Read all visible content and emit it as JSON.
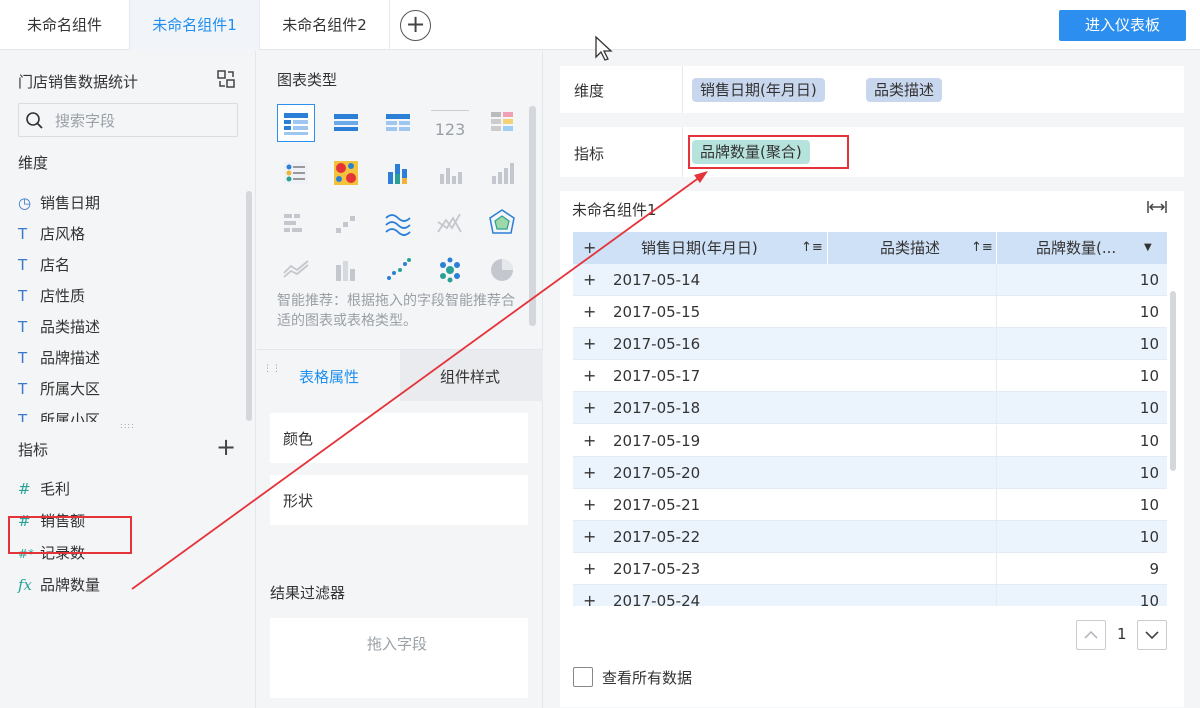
{
  "tabs": [
    {
      "label": "未命名组件"
    },
    {
      "label": "未命名组件1"
    },
    {
      "label": "未命名组件2"
    }
  ],
  "add_tab_symbol": "+",
  "enter_dashboard_label": "进入仪表板",
  "left": {
    "dataset_title": "门店销售数据统计",
    "search_placeholder": "搜索字段",
    "dimensions_label": "维度",
    "dimension_fields": [
      {
        "label": "销售日期",
        "icon": "clock-icon",
        "glyph": "◷"
      },
      {
        "label": "店风格",
        "icon": "text-type-icon",
        "glyph": "T"
      },
      {
        "label": "店名",
        "icon": "text-type-icon",
        "glyph": "T"
      },
      {
        "label": "店性质",
        "icon": "text-type-icon",
        "glyph": "T"
      },
      {
        "label": "品类描述",
        "icon": "text-type-icon",
        "glyph": "T"
      },
      {
        "label": "品牌描述",
        "icon": "text-type-icon",
        "glyph": "T"
      },
      {
        "label": "所属大区",
        "icon": "text-type-icon",
        "glyph": "T"
      },
      {
        "label": "所属小区",
        "icon": "text-type-icon",
        "glyph": "T"
      }
    ],
    "metrics_label": "指标",
    "add_metric_symbol": "+",
    "metric_fields": [
      {
        "label": "毛利",
        "icon": "number-icon",
        "glyph": "#"
      },
      {
        "label": "销售额",
        "icon": "number-icon",
        "glyph": "#"
      },
      {
        "label": "记录数",
        "icon": "count-number-icon",
        "glyph": "#*"
      },
      {
        "label": "品牌数量",
        "icon": "formula-icon",
        "glyph": "fx"
      }
    ]
  },
  "middle": {
    "chart_type_title": "图表类型",
    "smart_recommend_text": "智能推荐：根据拖入的字段智能推荐合适的图表或表格类型。",
    "tab_table_props": "表格属性",
    "tab_component_style": "组件样式",
    "prop_color": "颜色",
    "prop_shape": "形状",
    "result_filter_title": "结果过滤器",
    "drop_field_hint": "拖入字段",
    "chart_icon_label_123": "123"
  },
  "right": {
    "dimension_label": "维度",
    "dimension_pills": [
      "销售日期(年月日)",
      "品类描述"
    ],
    "metric_label": "指标",
    "metric_pills": [
      "品牌数量(聚合)"
    ],
    "component_title": "未命名组件1",
    "table": {
      "headers": [
        "销售日期(年月日)",
        "品类描述",
        "品牌数量(..."
      ],
      "rows": [
        {
          "date": "2017-05-14",
          "value": "10"
        },
        {
          "date": "2017-05-15",
          "value": "10"
        },
        {
          "date": "2017-05-16",
          "value": "10"
        },
        {
          "date": "2017-05-17",
          "value": "10"
        },
        {
          "date": "2017-05-18",
          "value": "10"
        },
        {
          "date": "2017-05-19",
          "value": "10"
        },
        {
          "date": "2017-05-20",
          "value": "10"
        },
        {
          "date": "2017-05-21",
          "value": "10"
        },
        {
          "date": "2017-05-22",
          "value": "10"
        },
        {
          "date": "2017-05-23",
          "value": "9"
        },
        {
          "date": "2017-05-24",
          "value": "10"
        }
      ]
    },
    "page_number": "1",
    "view_all_label": "查看所有数据"
  },
  "colors": {
    "accent": "#2c8ff0",
    "highlight_red": "#e5333a",
    "dimension_pill": "#c9d7ee",
    "metric_pill": "#b7e3dd",
    "table_header": "#cfe1f7",
    "table_row_alt": "#ebf3fd"
  }
}
